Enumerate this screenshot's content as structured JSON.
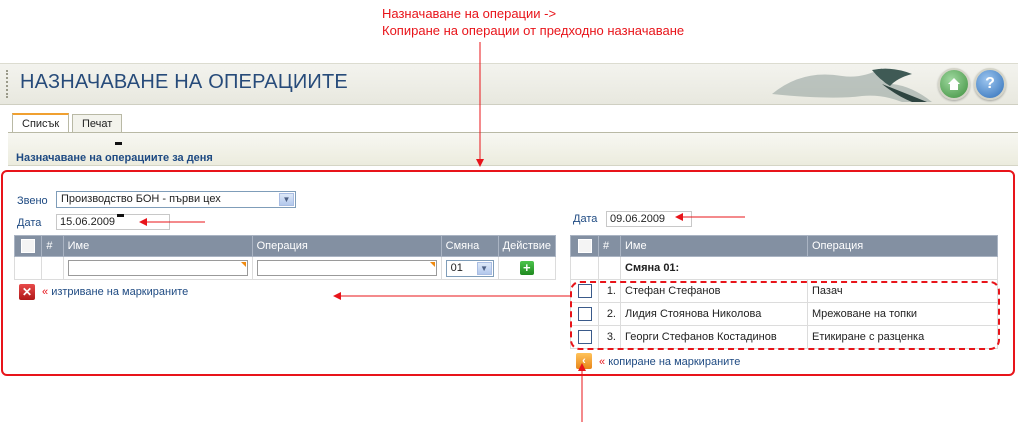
{
  "annotation": {
    "line1": "Назначаване на операции ->",
    "line2": "Копиране на операции от предходно назначаване"
  },
  "header": {
    "title": "НАЗНАЧАВАНЕ НА ОПЕРАЦИИТЕ",
    "home_icon": "home-icon",
    "help_label": "?"
  },
  "tabs": [
    {
      "label": "Списък",
      "active": true
    },
    {
      "label": "Печат",
      "active": false
    }
  ],
  "section_title": "Назначаване на операциите за деня",
  "left": {
    "unit_label": "Звено",
    "unit_value": "Производство БОН - първи цех",
    "date_label": "Дата",
    "date_value": "15.06.2009",
    "columns": [
      "#",
      "Име",
      "Операция",
      "Смяна",
      "Действие"
    ],
    "shift_value": "01",
    "add_label": "+",
    "delete_label": "изтриване на маркираните",
    "delete_prefix": "«"
  },
  "right": {
    "date_label": "Дата",
    "date_value": "09.06.2009",
    "columns": [
      "#",
      "Име",
      "Операция"
    ],
    "group_label": "Смяна 01:",
    "rows": [
      {
        "num": "1.",
        "name": "Стефан Стефанов",
        "operation": "Пазач"
      },
      {
        "num": "2.",
        "name": "Лидия Стоянова Николова",
        "operation": "Мрежоване на топки"
      },
      {
        "num": "3.",
        "name": "Георги Стефанов Костадинов",
        "operation": "Етикиране с разценка"
      }
    ],
    "copy_label": "копиране на маркираните",
    "copy_prefix": "«"
  },
  "colors": {
    "annotation_red": "#e8141a",
    "title_blue": "#274b7a",
    "grid_header": "#8390a2"
  }
}
